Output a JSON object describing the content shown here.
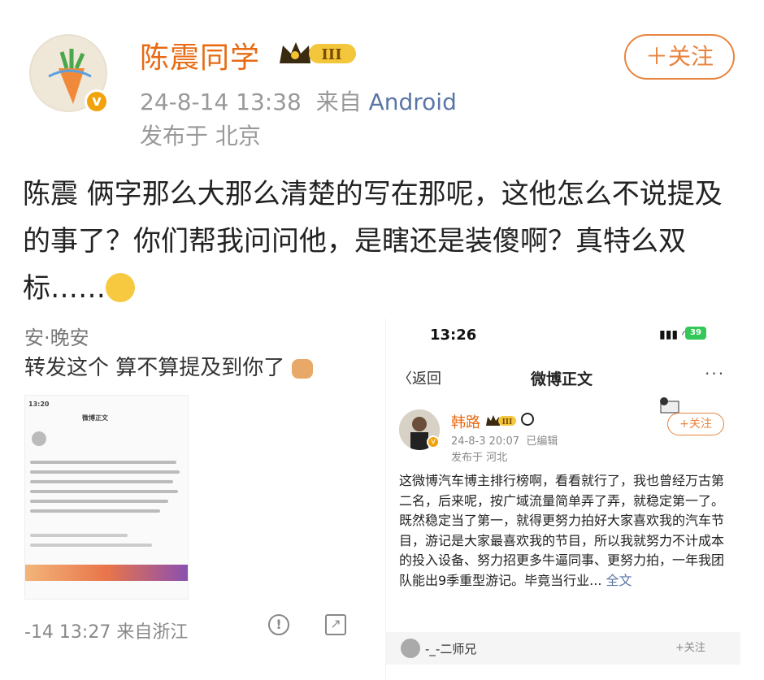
{
  "post": {
    "author": "陈震同学",
    "timestamp": "24-8-14 13:38",
    "source_prefix": "来自",
    "source": "Android",
    "location": "发布于 北京",
    "follow_label": "＋关注",
    "avatar_badge": "v",
    "level_badge": "III",
    "body_text": "陈震 俩字那么大那么清楚的写在那呢，这他怎么不说提及的事了？你们帮我问问他，是瞎还是装傻啊？真特么双标……",
    "emoji": "shush-face-emoji"
  },
  "left_image": {
    "name_line": "安·晚安",
    "text_line": "转发这个 算不算提及到你了",
    "footer": "-14 13:27 来自浙江",
    "icons": [
      "warning-icon",
      "share-icon"
    ],
    "mini_time": "13:20",
    "mini_title": "微博正文"
  },
  "right_image": {
    "status_time": "13:26",
    "battery": "39",
    "back_label": "〈返回",
    "title": "微博正文",
    "more": "···",
    "author": "韩路",
    "level_badge": "III",
    "timestamp": "24-8-3 20:07",
    "edited": "已编辑",
    "location": "发布于 河北",
    "follow_label": "+关注",
    "body": "这微博汽车博主排行榜啊，看看就行了，我也曾经万古第二名，后来呢，按广域流量简单弄了弄，就稳定第一了。既然稳定当了第一，就得更努力拍好大家喜欢我的汽车节目，游记是大家最喜欢我的节目，所以我就努力不计成本的投入设备、努力招更多牛逼同事、更努力拍，一年我团队能出9季重型游记。毕竟当行业...",
    "more_link": "全文",
    "comment_author": "-_-二师兄",
    "comment_follow": "+关注"
  },
  "colors": {
    "accent": "#e86b13",
    "link": "#5a76a6",
    "meta": "#999999"
  }
}
